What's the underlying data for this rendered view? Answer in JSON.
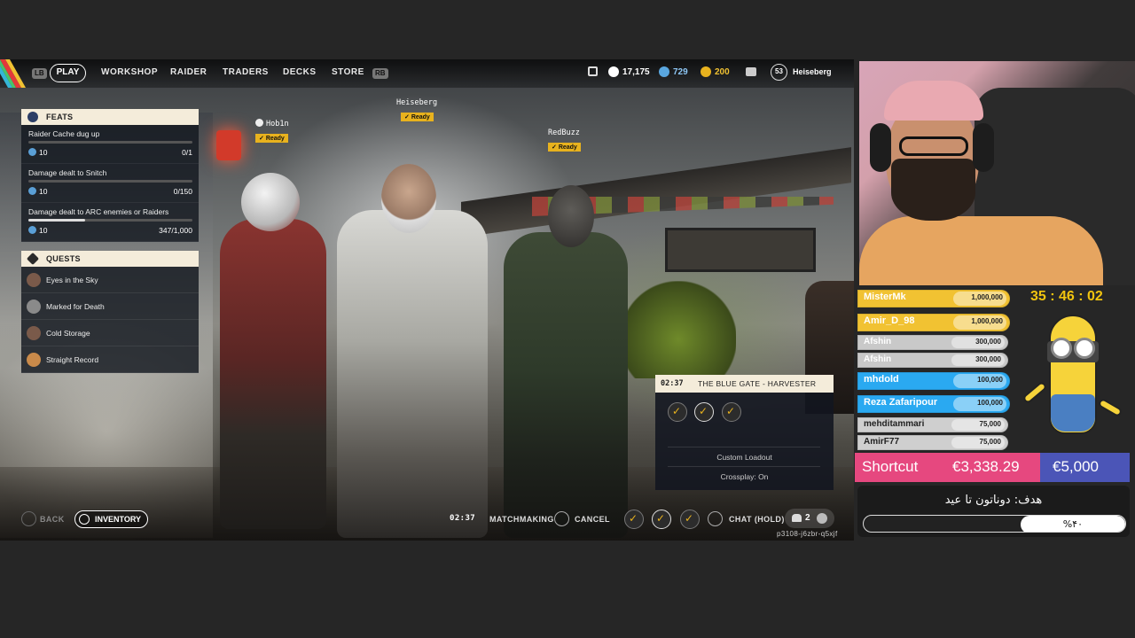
{
  "topnav": {
    "lb": "LB",
    "rb": "RB",
    "play": "PLAY",
    "items": [
      "WORKSHOP",
      "RAIDER",
      "TRADERS",
      "DECKS",
      "STORE"
    ],
    "currency_1": "17,175",
    "currency_2": "729",
    "currency_3": "200",
    "level": "53",
    "username": "Heiseberg"
  },
  "players": [
    {
      "name": "Hob1n",
      "status": "Ready"
    },
    {
      "name": "Heiseberg",
      "status": "Ready"
    },
    {
      "name": "RedBuzz",
      "status": "Ready"
    }
  ],
  "feats": {
    "title": "FEATS",
    "items": [
      {
        "title": "Raider Cache dug up",
        "points": "10",
        "progress": "0/1",
        "fill": 0
      },
      {
        "title": "Damage dealt to Snitch",
        "points": "10",
        "progress": "0/150",
        "fill": 0
      },
      {
        "title": "Damage dealt to ARC enemies or Raiders",
        "points": "10",
        "progress": "347/1,000",
        "fill": 0.347
      }
    ]
  },
  "quests": {
    "title": "QUESTS",
    "items": [
      "Eyes in the Sky",
      "Marked for Death",
      "Cold Storage",
      "Straight Record"
    ]
  },
  "matchmaking_card": {
    "timer": "02:37",
    "map": "THE BLUE GATE - HARVESTER",
    "loadout": "Custom Loadout",
    "crossplay": "Crossplay: On"
  },
  "bottombar": {
    "back": "BACK",
    "inventory": "INVENTORY",
    "timer": "02:37",
    "matchmaking": "MATCHMAKING",
    "cancel": "CANCEL",
    "chat": "CHAT (HOLD)",
    "party_count": "2",
    "session_id": "p3108-j6zbr-q5xjf"
  },
  "stream": {
    "timer": "35 : 46 : 02",
    "donors": [
      {
        "name": "MisterMk",
        "amount": "1,000,000",
        "color": "#f1c232",
        "text": "#ffffff"
      },
      {
        "name": "Amir_D_98",
        "amount": "1,000,000",
        "color": "#f1c232",
        "text": "#ffffff"
      },
      {
        "name": "Afshin",
        "amount": "300,000",
        "color": "#c9c9c9",
        "text": "#ffffff"
      },
      {
        "name": "Afshin",
        "amount": "300,000",
        "color": "#c9c9c9",
        "text": "#ffffff"
      },
      {
        "name": "mhdold",
        "amount": "100,000",
        "color": "#2aa9f1",
        "text": "#ffffff"
      },
      {
        "name": "Reza Zafaripour",
        "amount": "100,000",
        "color": "#2aa9f1",
        "text": "#ffffff"
      },
      {
        "name": "mehditammari",
        "amount": "75,000",
        "color": "#cfcfcf",
        "text": "#222222"
      },
      {
        "name": "AmirF77",
        "amount": "75,000",
        "color": "#cfcfcf",
        "text": "#222222"
      }
    ],
    "shortcut_label": "Shortcut",
    "raised": "€3,338.29",
    "goal_amount": "€5,000",
    "goal_text": "هدف: دوناتون تا عید",
    "goal_percent": "%۴۰",
    "goal_fill": 0.4
  }
}
